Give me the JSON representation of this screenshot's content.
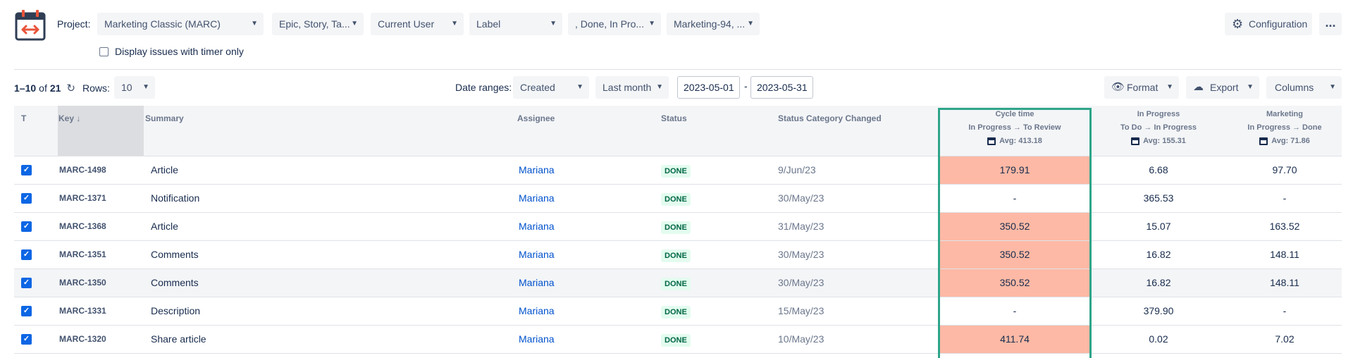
{
  "header": {
    "project_label": "Project:",
    "filters": [
      {
        "name": "project",
        "value": "Marketing Classic (MARC)"
      },
      {
        "name": "issue-type",
        "value": "Epic, Story, Ta..."
      },
      {
        "name": "user",
        "value": "Current User"
      },
      {
        "name": "label",
        "value": "Label"
      },
      {
        "name": "status",
        "value": ", Done, In Pro..."
      },
      {
        "name": "sprint",
        "value": "Marketing-94, ..."
      }
    ],
    "timer_only_label": "Display issues with timer only",
    "configuration_label": "Configuration",
    "more_label": "..."
  },
  "toolbar": {
    "range_text": "1–10",
    "of_text": "of",
    "total": "21",
    "rows_label": "Rows:",
    "rows_value": "10",
    "date_ranges_label": "Date ranges:",
    "date_field": "Created",
    "period": "Last month",
    "date_from": "2023-05-01",
    "date_to": "2023-05-31",
    "date_separator": "-",
    "format_label": "Format",
    "export_label": "Export",
    "columns_label": "Columns"
  },
  "table": {
    "headers": {
      "type": "T",
      "key": "Key ↓",
      "summary": "Summary",
      "assignee": "Assignee",
      "status": "Status",
      "status_changed": "Status Category Changed",
      "cycle": {
        "title": "Cycle time",
        "sub": "In Progress → To Review",
        "avg": "Avg: 413.18"
      },
      "inprogress": {
        "title": "In Progress",
        "sub": "To Do → In Progress",
        "avg": "Avg: 155.31"
      },
      "marketing": {
        "title": "Marketing",
        "sub": "In Progress → Done",
        "avg": "Avg: 71.86"
      }
    },
    "rows": [
      {
        "key": "MARC-1498",
        "summary": "Article",
        "assignee": "Mariana",
        "status": "DONE",
        "changed": "9/Jun/23",
        "cycle": "179.91",
        "inprogress": "6.68",
        "marketing": "97.70",
        "cycle_highlight": true
      },
      {
        "key": "MARC-1371",
        "summary": "Notification",
        "assignee": "Mariana",
        "status": "DONE",
        "changed": "30/May/23",
        "cycle": "-",
        "inprogress": "365.53",
        "marketing": "-",
        "cycle_highlight": false
      },
      {
        "key": "MARC-1368",
        "summary": "Article",
        "assignee": "Mariana",
        "status": "DONE",
        "changed": "31/May/23",
        "cycle": "350.52",
        "inprogress": "15.07",
        "marketing": "163.52",
        "cycle_highlight": true
      },
      {
        "key": "MARC-1351",
        "summary": "Comments",
        "assignee": "Mariana",
        "status": "DONE",
        "changed": "30/May/23",
        "cycle": "350.52",
        "inprogress": "16.82",
        "marketing": "148.11",
        "cycle_highlight": true
      },
      {
        "key": "MARC-1350",
        "summary": "Comments",
        "assignee": "Mariana",
        "status": "DONE",
        "changed": "30/May/23",
        "cycle": "350.52",
        "inprogress": "16.82",
        "marketing": "148.11",
        "cycle_highlight": true
      },
      {
        "key": "MARC-1331",
        "summary": "Description",
        "assignee": "Mariana",
        "status": "DONE",
        "changed": "15/May/23",
        "cycle": "-",
        "inprogress": "379.90",
        "marketing": "-",
        "cycle_highlight": false
      },
      {
        "key": "MARC-1320",
        "summary": "Share article",
        "assignee": "Mariana",
        "status": "DONE",
        "changed": "10/May/23",
        "cycle": "411.74",
        "inprogress": "0.02",
        "marketing": "7.02",
        "cycle_highlight": true
      }
    ]
  },
  "colors": {
    "highlight": "#fdb9a5",
    "selection_border": "#2ea58a",
    "done_badge_bg": "#e3fcef",
    "done_badge_text": "#006644",
    "checkbox": "#0c66e4",
    "link": "#0052cc"
  },
  "icons": [
    "calendar-timer-icon",
    "chevron-down-icon",
    "gear-icon",
    "more-icon",
    "refresh-icon",
    "eye-icon",
    "cloud-export-icon",
    "calendar-mini-icon",
    "checkbox-checked-icon"
  ]
}
